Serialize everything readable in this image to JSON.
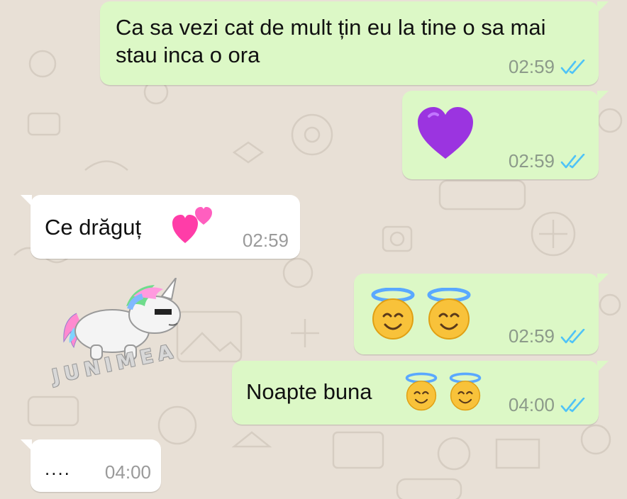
{
  "chat": {
    "messages": [
      {
        "text": "Ca sa vezi cat de mult țin eu la tine o sa mai stau inca o ora",
        "time": "02:59",
        "direction": "outgoing",
        "status": "read"
      },
      {
        "emoji": "purple-heart",
        "time": "02:59",
        "direction": "outgoing",
        "status": "read"
      },
      {
        "text": "Ce drăguț",
        "emoji": "two-hearts",
        "time": "02:59",
        "direction": "incoming"
      },
      {
        "emoji": "smiling-face-with-halo x2",
        "time": "02:59",
        "direction": "outgoing",
        "status": "read"
      },
      {
        "text": "Noapte buna",
        "emoji": "smiling-face-with-halo x2",
        "time": "04:00",
        "direction": "outgoing",
        "status": "read"
      },
      {
        "text": "....",
        "time": "04:00",
        "direction": "incoming"
      }
    ]
  },
  "watermark": {
    "text": "JUNIMEA"
  },
  "colors": {
    "background": "#e8e0d6",
    "outgoing_bubble": "#dcf8c6",
    "incoming_bubble": "#ffffff",
    "read_ticks": "#4fc3f7",
    "purple_heart": "#9b34e0",
    "pink_hearts": "#ff3da8"
  },
  "icons": [
    "double-check-icon",
    "purple-heart-icon",
    "two-hearts-icon",
    "halo-face-icon",
    "unicorn-mascot"
  ]
}
